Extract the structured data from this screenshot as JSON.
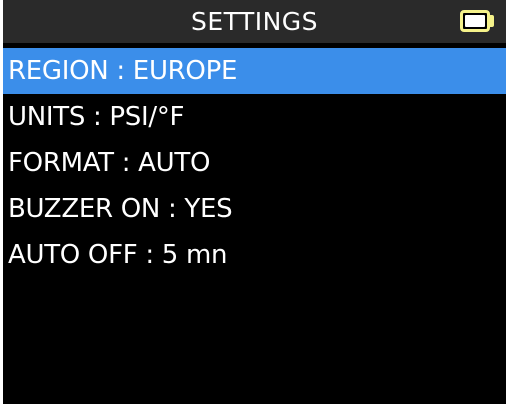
{
  "header": {
    "title": "SETTINGS",
    "battery_icon": "battery-full-icon",
    "battery_outline_color": "#f5f28a"
  },
  "menu": {
    "selected_index": 0,
    "highlight_color": "#3b8eea",
    "items": [
      {
        "label": "REGION  :  EUROPE"
      },
      {
        "label": "UNITS  :  PSI/°F"
      },
      {
        "label": "FORMAT  :  AUTO"
      },
      {
        "label": "BUZZER ON  : YES"
      },
      {
        "label": "AUTO OFF  :  5 mn"
      }
    ]
  }
}
